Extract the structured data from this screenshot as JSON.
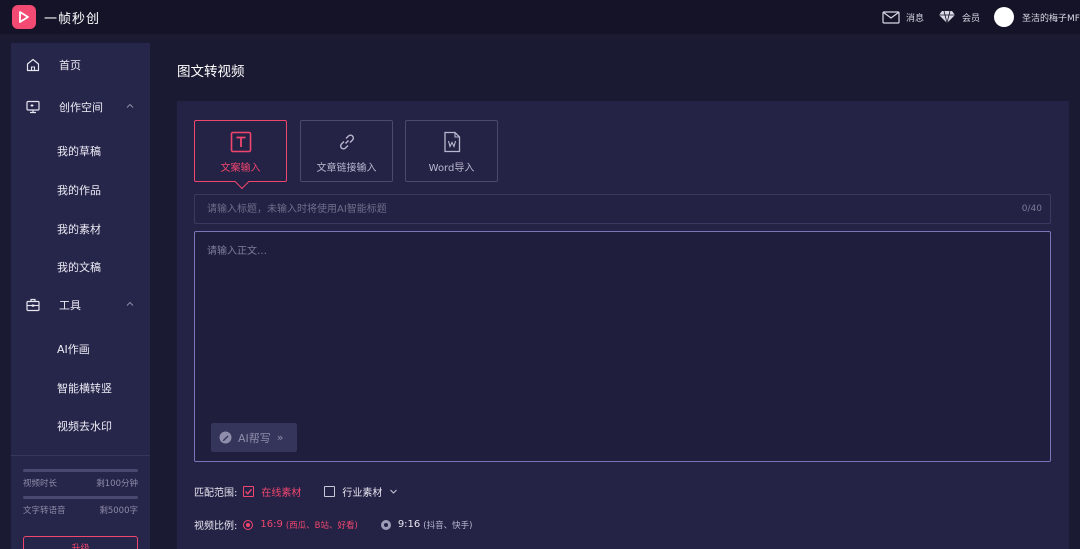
{
  "app": {
    "name": "一帧秒创",
    "accent_color": "#f0466e",
    "logo_icon": "play-logo-icon"
  },
  "topbar": {
    "messages_label": "消息",
    "messages_icon": "mail-icon",
    "vip_label": "会员",
    "vip_icon": "diamond-icon",
    "username": "圣洁的梅子MF"
  },
  "sidebar": {
    "home": {
      "label": "首页",
      "icon": "home-icon"
    },
    "creation": {
      "label": "创作空间",
      "icon": "monitor-icon",
      "items": [
        "我的草稿",
        "我的作品",
        "我的素材",
        "我的文稿"
      ]
    },
    "tools": {
      "label": "工具",
      "icon": "toolbox-icon",
      "items": [
        "AI作画",
        "智能横转竖",
        "视频去水印"
      ]
    },
    "usage": [
      {
        "label": "视频时长",
        "value": "剩100分钟",
        "progress": 0
      },
      {
        "label": "文字转语音",
        "value": "剩5000字",
        "progress": 0
      }
    ],
    "upgrade_label": "升级"
  },
  "main": {
    "page_title": "图文转视频",
    "tabs": [
      {
        "label": "文案输入",
        "icon": "text-t-icon",
        "active": true
      },
      {
        "label": "文章链接输入",
        "icon": "link-icon",
        "active": false
      },
      {
        "label": "Word导入",
        "icon": "word-file-icon",
        "active": false
      }
    ],
    "title_input": {
      "placeholder": "请输入标题，未输入时将使用AI智能标题",
      "value": "",
      "counter": "0/40"
    },
    "body_input": {
      "placeholder": "请输入正文…",
      "value": ""
    },
    "ai_write": {
      "label": "AI帮写",
      "arrow": "»",
      "icon": "ai-pen-icon"
    },
    "match": {
      "label": "匹配范围:",
      "options": [
        {
          "label": "在线素材",
          "checked": true
        },
        {
          "label": "行业素材",
          "checked": false
        }
      ]
    },
    "ratio": {
      "label": "视频比例:",
      "options": [
        {
          "value": "16:9",
          "note": "(西瓜、B站、好看)",
          "selected": true
        },
        {
          "value": "9:16",
          "note": "(抖音、快手)",
          "selected": false
        }
      ]
    }
  }
}
